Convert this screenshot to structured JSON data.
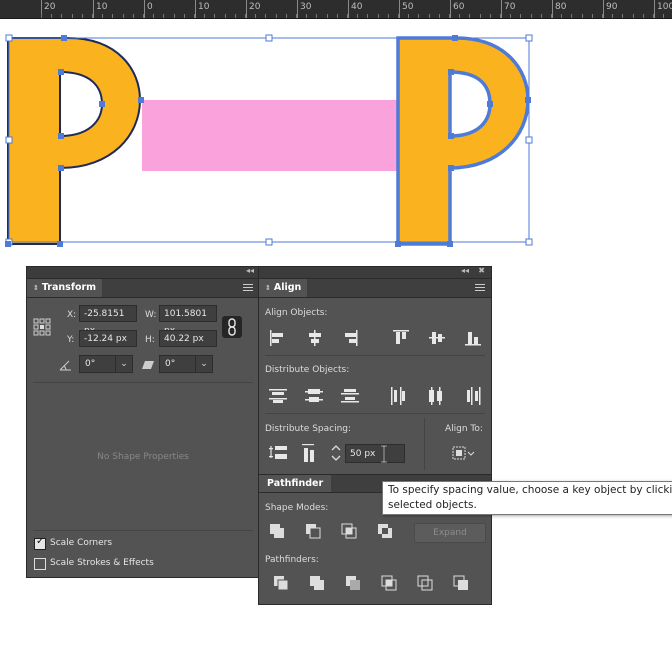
{
  "ruler": {
    "ticks": [
      "20",
      "10",
      "0",
      "10",
      "20",
      "30",
      "40",
      "50",
      "60",
      "70",
      "80",
      "90",
      "100"
    ]
  },
  "colors": {
    "accent": "#4e7bd8",
    "letter_fill": "#fbb21f",
    "pink_rect": "#f9a2db",
    "panel": "#535353"
  },
  "transform": {
    "tab": "Transform",
    "x_label": "X:",
    "x_value": "-25.8151 px",
    "w_label": "W:",
    "w_value": "101.5801 px",
    "y_label": "Y:",
    "y_value": "-12.24 px",
    "h_label": "H:",
    "h_value": "40.22 px",
    "rotate_value": "0°",
    "shear_value": "0°",
    "no_shape": "No Shape Properties",
    "scale_corners": "Scale Corners",
    "scale_corners_checked": true,
    "scale_strokes": "Scale Strokes & Effects",
    "scale_strokes_checked": false
  },
  "align": {
    "tab": "Align",
    "align_objects": "Align Objects:",
    "distribute_objects": "Distribute Objects:",
    "distribute_spacing": "Distribute Spacing:",
    "align_to": "Align To:",
    "spacing_value": "50 px"
  },
  "pathfinder": {
    "tab": "Pathfinder",
    "shape_modes": "Shape Modes:",
    "expand": "Expand",
    "pathfinders": "Pathfinders:"
  },
  "tooltip": {
    "line1": "To specify spacing value, choose a key object by clicki",
    "line2": "selected objects."
  }
}
